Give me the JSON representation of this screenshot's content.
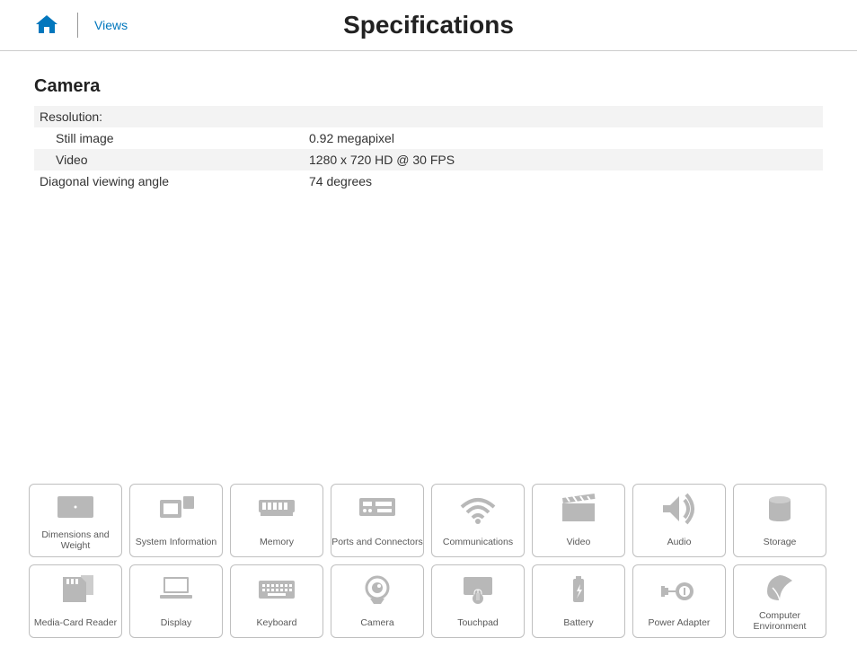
{
  "nav": {
    "views_label": "Views"
  },
  "page": {
    "title": "Specifications"
  },
  "section": {
    "title": "Camera",
    "rows": [
      {
        "label": "Resolution:",
        "value": "",
        "shaded": true,
        "indent": false
      },
      {
        "label": "Still image",
        "value": "0.92 megapixel",
        "shaded": false,
        "indent": true
      },
      {
        "label": "Video",
        "value": "1280 x 720 HD @ 30 FPS",
        "shaded": true,
        "indent": true
      },
      {
        "label": "Diagonal viewing angle",
        "value": "74 degrees",
        "shaded": false,
        "indent": false
      }
    ]
  },
  "bottom_nav": [
    {
      "id": "dimensions",
      "label": "Dimensions and Weight",
      "icon": "laptop-closed"
    },
    {
      "id": "system-info",
      "label": "System Information",
      "icon": "chip"
    },
    {
      "id": "memory",
      "label": "Memory",
      "icon": "ram"
    },
    {
      "id": "ports",
      "label": "Ports and Connectors",
      "icon": "ports"
    },
    {
      "id": "communications",
      "label": "Communications",
      "icon": "wifi"
    },
    {
      "id": "video",
      "label": "Video",
      "icon": "clapper"
    },
    {
      "id": "audio",
      "label": "Audio",
      "icon": "speaker"
    },
    {
      "id": "storage",
      "label": "Storage",
      "icon": "drive"
    },
    {
      "id": "media-card",
      "label": "Media-Card Reader",
      "icon": "sdcard"
    },
    {
      "id": "display",
      "label": "Display",
      "icon": "laptop-open"
    },
    {
      "id": "keyboard",
      "label": "Keyboard",
      "icon": "keyboard"
    },
    {
      "id": "camera",
      "label": "Camera",
      "icon": "webcam"
    },
    {
      "id": "touchpad",
      "label": "Touchpad",
      "icon": "touchpad"
    },
    {
      "id": "battery",
      "label": "Battery",
      "icon": "battery"
    },
    {
      "id": "power-adapter",
      "label": "Power Adapter",
      "icon": "adapter"
    },
    {
      "id": "environment",
      "label": "Computer Environment",
      "icon": "leaf"
    }
  ]
}
